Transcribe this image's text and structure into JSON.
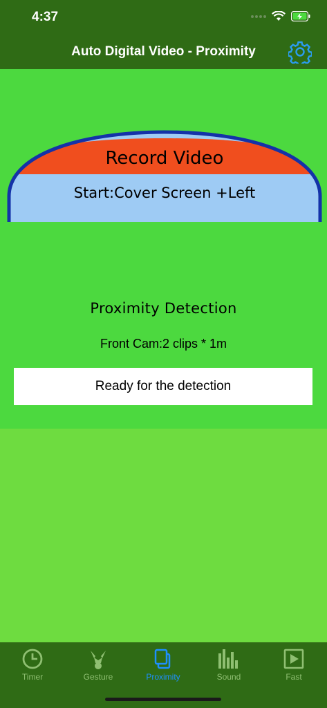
{
  "status": {
    "time": "4:37"
  },
  "header": {
    "title": "Auto Digital Video - Proximity"
  },
  "record": {
    "title": "Record Video",
    "subtitle": "Start:Cover Screen +Left"
  },
  "proximity": {
    "title": "Proximity Detection",
    "clips": "Front Cam:2 clips * 1m",
    "status": "Ready for the detection"
  },
  "tabs": [
    {
      "label": "Timer",
      "icon": "clock-icon",
      "active": false
    },
    {
      "label": "Gesture",
      "icon": "gesture-icon",
      "active": false
    },
    {
      "label": "Proximity",
      "icon": "proximity-icon",
      "active": true
    },
    {
      "label": "Sound",
      "icon": "sound-bars-icon",
      "active": false
    },
    {
      "label": "Fast",
      "icon": "play-icon",
      "active": false
    }
  ],
  "colors": {
    "header_bg": "#2f6b15",
    "panel_bg": "#4cd93f",
    "page_bg": "#6edc40",
    "accent": "#1e90ff",
    "record_red": "#f04e1e",
    "record_blue": "#9ecbf4",
    "record_border": "#1432a8"
  }
}
